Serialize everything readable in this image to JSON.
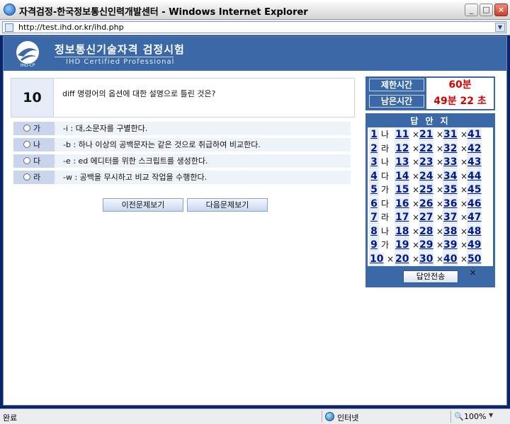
{
  "window": {
    "title": "자격검정-한국정보통신인력개발센터 - Windows Internet Explorer"
  },
  "address": {
    "url": "http://test.ihd.or.kr/ihd.php"
  },
  "brand": {
    "title": "정보통신기술자격 검정시험",
    "subtitle": "IHD Certified Professional",
    "logo_text": "IHD-CP"
  },
  "question": {
    "number": "10",
    "text": "diff 명령어의 옵션에 대한 설명으로 틀린 것은?",
    "options": [
      {
        "label": "가",
        "text": "-i : 대,소문자를 구별한다."
      },
      {
        "label": "나",
        "text": "-b : 하나 이상의 공백문자는 같은 것으로 취급하여 비교한다."
      },
      {
        "label": "다",
        "text": "-e : ed 에디터를 위한 스크립트를 생성한다."
      },
      {
        "label": "라",
        "text": "-w : 공백을 무시하고 비교 작업을 수행한다."
      }
    ]
  },
  "nav": {
    "prev_label": "이전문제보기",
    "next_label": "다음문제보기"
  },
  "timer": {
    "limit_label": "제한시간",
    "limit_value": "60분",
    "remain_label": "남은시간",
    "remain_value": "49분 22 초"
  },
  "answer_sheet": {
    "title": "답 안 지",
    "submit_label": "답안전송",
    "rows": [
      [
        {
          "n": "1",
          "a": "나"
        },
        {
          "n": "11",
          "a": "×"
        },
        {
          "n": "21",
          "a": "×"
        },
        {
          "n": "31",
          "a": "×"
        },
        {
          "n": "41",
          "a": "×"
        }
      ],
      [
        {
          "n": "2",
          "a": "라"
        },
        {
          "n": "12",
          "a": "×"
        },
        {
          "n": "22",
          "a": "×"
        },
        {
          "n": "32",
          "a": "×"
        },
        {
          "n": "42",
          "a": "×"
        }
      ],
      [
        {
          "n": "3",
          "a": "나"
        },
        {
          "n": "13",
          "a": "×"
        },
        {
          "n": "23",
          "a": "×"
        },
        {
          "n": "33",
          "a": "×"
        },
        {
          "n": "43",
          "a": "×"
        }
      ],
      [
        {
          "n": "4",
          "a": "다"
        },
        {
          "n": "14",
          "a": "×"
        },
        {
          "n": "24",
          "a": "×"
        },
        {
          "n": "34",
          "a": "×"
        },
        {
          "n": "44",
          "a": "×"
        }
      ],
      [
        {
          "n": "5",
          "a": "가"
        },
        {
          "n": "15",
          "a": "×"
        },
        {
          "n": "25",
          "a": "×"
        },
        {
          "n": "35",
          "a": "×"
        },
        {
          "n": "45",
          "a": "×"
        }
      ],
      [
        {
          "n": "6",
          "a": "다"
        },
        {
          "n": "16",
          "a": "×"
        },
        {
          "n": "26",
          "a": "×"
        },
        {
          "n": "36",
          "a": "×"
        },
        {
          "n": "46",
          "a": "×"
        }
      ],
      [
        {
          "n": "7",
          "a": "라"
        },
        {
          "n": "17",
          "a": "×"
        },
        {
          "n": "27",
          "a": "×"
        },
        {
          "n": "37",
          "a": "×"
        },
        {
          "n": "47",
          "a": "×"
        }
      ],
      [
        {
          "n": "8",
          "a": "나"
        },
        {
          "n": "18",
          "a": "×"
        },
        {
          "n": "28",
          "a": "×"
        },
        {
          "n": "38",
          "a": "×"
        },
        {
          "n": "48",
          "a": "×"
        }
      ],
      [
        {
          "n": "9",
          "a": "가"
        },
        {
          "n": "19",
          "a": "×"
        },
        {
          "n": "29",
          "a": "×"
        },
        {
          "n": "39",
          "a": "×"
        },
        {
          "n": "49",
          "a": "×"
        }
      ],
      [
        {
          "n": "10",
          "a": "×"
        },
        {
          "n": "20",
          "a": "×"
        },
        {
          "n": "30",
          "a": "×"
        },
        {
          "n": "40",
          "a": "×"
        },
        {
          "n": "50",
          "a": "×"
        }
      ]
    ]
  },
  "status": {
    "text": "완료",
    "zone": "인터넷",
    "zoom": "100%"
  },
  "colors": {
    "brand_blue": "#3b68a7",
    "timer_red": "#d40000",
    "option_label_bg": "#c9d5ec"
  }
}
